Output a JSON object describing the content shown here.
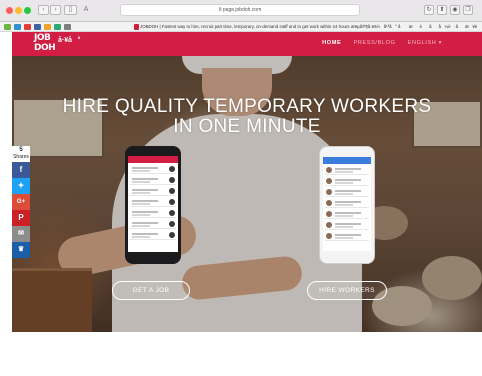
{
  "browser": {
    "back_icon": "chevron-left-icon",
    "forward_icon": "chevron-right-icon",
    "sidebar_icon": "sidebar-icon",
    "reader_label": "A",
    "address": "ð page.jobdoh.com",
    "reload_icon": "reload-icon",
    "tab_text": "JOBDOH | Fastest way to hire, recruit part time, temporary, on-demand staff and to get work within 24 hours æ¥µå®¶å·¥ä½å¹³å° ã æèãå¼è·ãæ¥èªãå·¥ä½ãå·¥"
  },
  "header": {
    "logo_line1": "JOB",
    "logo_line2": "DOH",
    "logo_cn": "å·¥å°",
    "nav": {
      "home": "HOME",
      "press": "PRESS/BLOG",
      "language": "ENGLISH ▾"
    }
  },
  "hero": {
    "title_line1": "HIRE QUALITY TEMPORARY WORKERS",
    "title_line2": "IN ONE MINUTE",
    "cta_job": "GET A JOB",
    "cta_hire": "HIRE WORKERS"
  },
  "share": {
    "count": "5",
    "count_label": "Shares",
    "facebook": "f",
    "twitter": "ð¦",
    "googleplus": "G+",
    "pinterest": "P",
    "email": "✉",
    "crown": "♛"
  },
  "colors": {
    "brand": "#d21e43",
    "facebook": "#3b5998",
    "twitter": "#1da1f2",
    "googleplus": "#dd4b39",
    "pinterest": "#cb2027"
  }
}
